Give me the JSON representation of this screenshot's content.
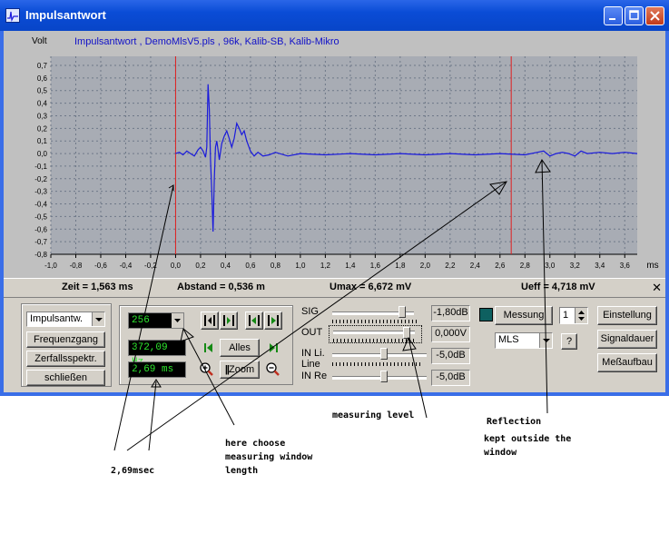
{
  "window": {
    "title": "Impulsantwort"
  },
  "plot": {
    "volt_label": "Volt",
    "title": "Impulsantwort , DemoMlsV5.pls , 96k, Kalib-SB, Kalib-Mikro",
    "x_unit": "ms"
  },
  "chart_data": {
    "type": "line",
    "title": "Impulsantwort , DemoMlsV5.pls , 96k, Kalib-SB, Kalib-Mikro",
    "xlabel": "ms",
    "ylabel": "Volt",
    "xlim": [
      -1.0,
      3.7
    ],
    "ylim": [
      -0.8,
      0.7
    ],
    "grid": true,
    "x_ticks": [
      "-1,0",
      "-0,8",
      "-0,6",
      "-0,4",
      "-0,2",
      "0,0",
      "0,2",
      "0,4",
      "0,6",
      "0,8",
      "1,0",
      "1,2",
      "1,4",
      "1,6",
      "1,8",
      "2,0",
      "2,2",
      "2,4",
      "2,6",
      "2,8",
      "3,0",
      "3,2",
      "3,4",
      "3,6"
    ],
    "y_ticks": [
      "0,7",
      "0,6",
      "0,5",
      "0,4",
      "0,3",
      "0,2",
      "0,1",
      "0,0",
      "-0,1",
      "-0,2",
      "-0,3",
      "-0,4",
      "-0,5",
      "-0,6",
      "-0,7",
      "-0,8"
    ],
    "markers_x": [
      0.0,
      2.69
    ],
    "series": [
      {
        "color": "#1a1adc",
        "x": [
          0.0,
          0.03,
          0.06,
          0.09,
          0.12,
          0.15,
          0.18,
          0.2,
          0.22,
          0.24,
          0.25,
          0.26,
          0.27,
          0.28,
          0.29,
          0.3,
          0.31,
          0.32,
          0.33,
          0.34,
          0.35,
          0.37,
          0.39,
          0.41,
          0.43,
          0.45,
          0.47,
          0.49,
          0.51,
          0.53,
          0.55,
          0.57,
          0.6,
          0.63,
          0.66,
          0.7,
          0.75,
          0.8,
          0.9,
          1.0,
          1.2,
          1.4,
          1.6,
          1.8,
          2.0,
          2.2,
          2.4,
          2.6,
          2.8,
          2.9,
          2.95,
          3.0,
          3.05,
          3.1,
          3.15,
          3.2,
          3.25,
          3.3,
          3.4,
          3.5,
          3.6,
          3.7
        ],
        "y": [
          0.0,
          0.01,
          -0.01,
          0.02,
          0.0,
          -0.02,
          0.03,
          0.05,
          0.02,
          -0.03,
          0.05,
          0.55,
          0.35,
          -0.05,
          -0.3,
          -0.62,
          -0.2,
          0.05,
          0.1,
          0.03,
          -0.05,
          0.08,
          0.14,
          0.18,
          0.12,
          0.05,
          0.12,
          0.24,
          0.2,
          0.15,
          0.18,
          0.1,
          0.02,
          -0.02,
          0.01,
          -0.02,
          -0.01,
          0.01,
          -0.02,
          0.0,
          -0.01,
          0.0,
          -0.01,
          0.0,
          -0.01,
          0.0,
          -0.01,
          0.0,
          -0.01,
          0.01,
          0.02,
          -0.02,
          0.0,
          0.01,
          0.0,
          -0.02,
          0.02,
          0.0,
          0.01,
          0.0,
          0.01,
          0.0
        ]
      }
    ]
  },
  "status": {
    "zeit": "Zeit = 1,563 ms",
    "abstand": "Abstand = 0,536 m",
    "umax": "Umax = 6,672 mV",
    "ueff": "Ueff = 4,718 mV",
    "close": "✕"
  },
  "left_panel": {
    "mode_select": "Impulsantw.",
    "btn_freq": "Frequenzgang",
    "btn_decay": "Zerfallsspektr.",
    "btn_close": "schließen"
  },
  "mid_panel": {
    "length_select": "256",
    "freq_value": "372,09 Hz",
    "time_value": "2,69 ms",
    "btn_all": "Alles",
    "btn_zoom": "Zoom"
  },
  "levels": {
    "sig_label": "SIG",
    "sig_value": "-1,80dB",
    "sig_level": 0.86,
    "out_label": "OUT",
    "out_value": "0,000V",
    "out_level": 0.9,
    "inli_label": "IN Li.",
    "line_label": "Line",
    "inli_value": "-5,0dB",
    "inli_level": 0.55,
    "inre_label": "IN Re",
    "inre_value": "-5,0dB",
    "inre_level": 0.55
  },
  "right_panel": {
    "btn_messung": "Messung",
    "count_value": "1",
    "mls_select": "MLS",
    "help": "?",
    "btn_einstellung": "Einstellung",
    "btn_signaldauer": "Signaldauer",
    "btn_messaufbau": "Meßaufbau"
  },
  "annotations": {
    "a1": "2,69msec",
    "a2_l1": "here choose",
    "a2_l2": "measuring window",
    "a2_l3": "length",
    "a3": "measuring level",
    "a4": "Reflection",
    "a5_l1": "kept outside the",
    "a5_l2": "window"
  }
}
